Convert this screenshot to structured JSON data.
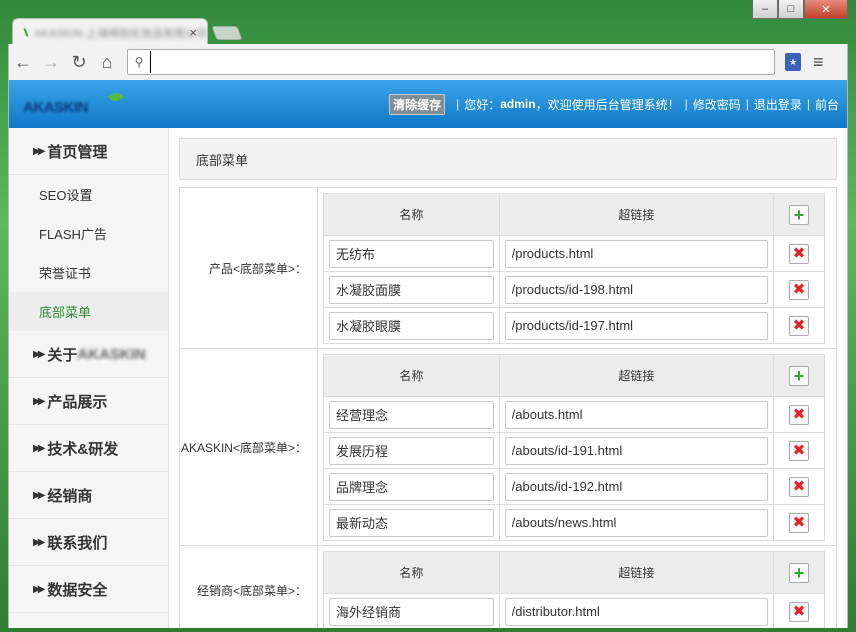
{
  "browser": {
    "tab_title": "AKASKIN-上海缔刻化妆品有限公司",
    "close_glyph": "×",
    "address_value": "",
    "window_controls": [
      "–",
      "□",
      "✕"
    ]
  },
  "header": {
    "logo_text": "AKASKIN",
    "clear_cache": "清除缓存",
    "greeting_prefix": "您好：",
    "username": "admin",
    "greeting_suffix": "，欢迎使用后台管理系统！",
    "change_password": "修改密码",
    "logout": "退出登录",
    "frontend": "前台",
    "separator": "|"
  },
  "sidebar": {
    "categories": [
      {
        "label": "首页管理",
        "subitems": [
          {
            "label": "SEO设置"
          },
          {
            "label": "FLASH广告"
          },
          {
            "label": "荣誉证书"
          },
          {
            "label": "底部菜单",
            "active": true
          }
        ]
      },
      {
        "label": "关于",
        "label_suffix": "AKASKIN"
      },
      {
        "label": "产品展示"
      },
      {
        "label": "技术&研发"
      },
      {
        "label": "经销商"
      },
      {
        "label": "联系我们"
      },
      {
        "label": "数据安全"
      }
    ]
  },
  "main": {
    "section_title": "底部菜单",
    "col_name": "名称",
    "col_link": "超链接",
    "groups": [
      {
        "label": "产品<底部菜单>：",
        "rows": [
          {
            "name": "无纺布",
            "link": "/products.html"
          },
          {
            "name": "水凝胶面膜",
            "link": "/products/id-198.html"
          },
          {
            "name": "水凝胶眼膜",
            "link": "/products/id-197.html"
          }
        ]
      },
      {
        "label": "AKASKIN<底部菜单>：",
        "rows": [
          {
            "name": "经营理念",
            "link": "/abouts.html"
          },
          {
            "name": "发展历程",
            "link": "/abouts/id-191.html"
          },
          {
            "name": "品牌理念",
            "link": "/abouts/id-192.html"
          },
          {
            "name": "最新动态",
            "link": "/abouts/news.html"
          }
        ]
      },
      {
        "label": "经销商<底部菜单>：",
        "rows": [
          {
            "name": "海外经销商",
            "link": "/distributor.html"
          }
        ]
      }
    ]
  },
  "colors": {
    "header_top": "#3aa4e8",
    "header_bottom": "#0f78c8",
    "active_sidebar": "#2d8a2d",
    "add_icon": "#38a53a",
    "delete_icon": "#e02424"
  },
  "icons": {
    "add": "+",
    "delete": "✖",
    "back": "←",
    "forward": "→",
    "reload": "↻",
    "home": "⌂",
    "search": "🔍",
    "menu": "≡"
  }
}
